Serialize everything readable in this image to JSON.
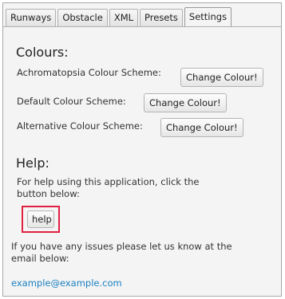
{
  "tabs": [
    {
      "label": "Runways"
    },
    {
      "label": "Obstacle"
    },
    {
      "label": "XML"
    },
    {
      "label": "Presets"
    },
    {
      "label": "Settings",
      "active": true
    }
  ],
  "colours": {
    "heading": "Colours:",
    "schemes": [
      {
        "label": "Achromatopsia Colour Scheme:",
        "button": "Change Colour!"
      },
      {
        "label": "Default Colour Scheme:",
        "button": "Change Colour!"
      },
      {
        "label": "Alternative Colour Scheme:",
        "button": "Change Colour!"
      }
    ]
  },
  "help": {
    "heading": "Help:",
    "line1": "For help using this application, click the",
    "line2": "button below:",
    "button": "help",
    "issues_line1": "If you have any issues please let us know at the",
    "issues_line2": "email below:",
    "email": "example@example.com"
  },
  "colors": {
    "highlight_border": "#e02040",
    "link": "#1a7fc1"
  }
}
